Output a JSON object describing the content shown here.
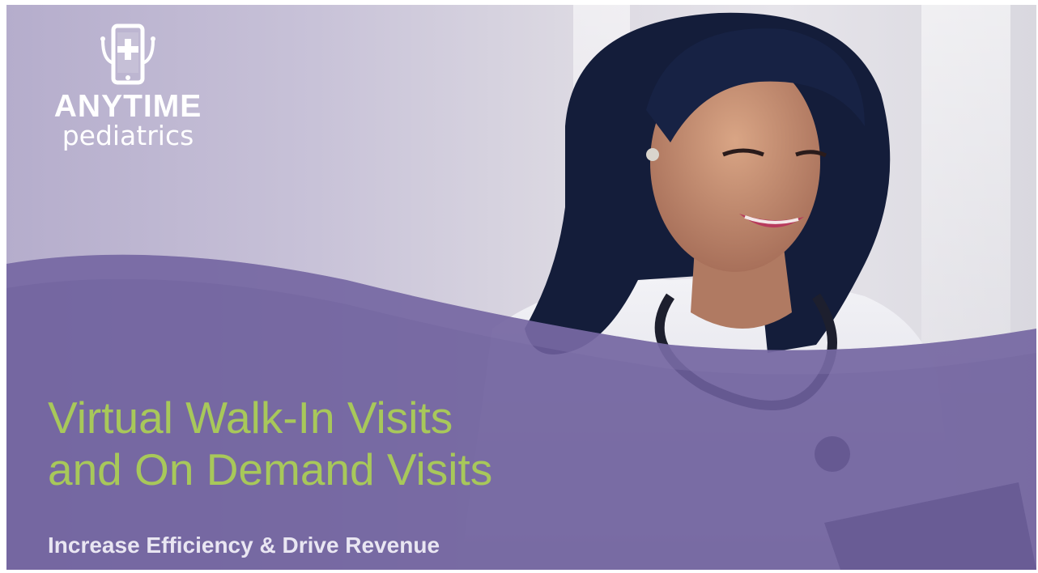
{
  "slide": {
    "logo": {
      "icon": "tablet-medical-cross-icon",
      "brand_top": "ANYTIME",
      "brand_bottom": "pediatrics"
    },
    "headline": {
      "line1": "Virtual Walk-In Visits",
      "line2": "and On Demand Visits"
    },
    "subtitle": "Increase Efficiency & Drive Revenue",
    "colors": {
      "headline": "#a8c85a",
      "wave": "#6e5f9c",
      "subtitle": "#e9e6f2",
      "logo": "#ffffff"
    }
  }
}
